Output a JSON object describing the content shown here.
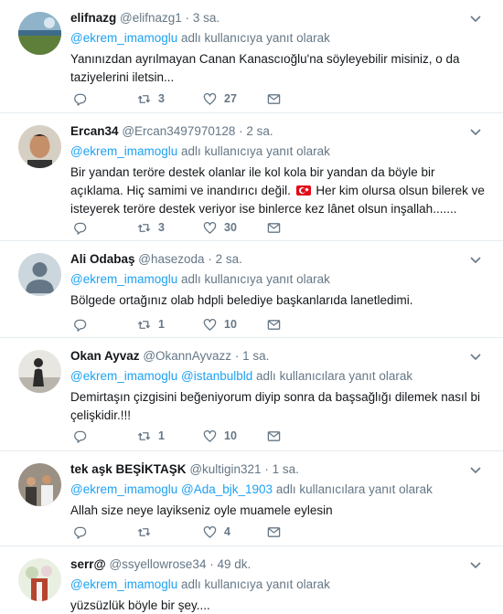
{
  "colors": {
    "link": "#1da1f2",
    "secondary_text": "#657786",
    "divider": "#e6ecf0"
  },
  "replying_text": "adlı kullanıcıya yanıt olarak",
  "replying_text_plural": "adlı kullanıcılara yanıt olarak",
  "tweets": [
    {
      "name": "elifnazg",
      "handle": "@elifnazg1",
      "time": "3 sa.",
      "mentions": [
        "@ekrem_imamoglu"
      ],
      "text": "Yanınızdan ayrılmayan Canan Kanascıoğlu'na söyleyebilir misiniz, o da taziyelerini iletsin...",
      "replies": "",
      "retweets": "3",
      "likes": "27",
      "avatar_icon": "landscape-photo"
    },
    {
      "name": "Ercan34",
      "handle": "@Ercan3497970128",
      "time": "2 sa.",
      "mentions": [
        "@ekrem_imamoglu"
      ],
      "text_before_flag": "Bir yandan teröre destek olanlar ile kol kola bir yandan da böyle bir açıklama. Hiç samimi ve inandırıcı değil.",
      "flag_icon": "turkey-flag-emoji",
      "text_after_flag": "Her kim olursa olsun bilerek ve isteyerek teröre destek veriyor ise binlerce kez lânet olsun inşallah.......",
      "replies": "",
      "retweets": "3",
      "likes": "30",
      "avatar_icon": "portrait-photo"
    },
    {
      "name": "Ali Odabaş",
      "handle": "@hasezoda",
      "time": "2 sa.",
      "mentions": [
        "@ekrem_imamoglu"
      ],
      "text": "Bölgede ortağınız olab hdpli belediye başkanlarıda lanetledimi.",
      "replies": "",
      "retweets": "1",
      "likes": "10",
      "avatar_icon": "default-avatar"
    },
    {
      "name": "Okan Ayvaz",
      "handle": "@OkannAyvazz",
      "time": "1 sa.",
      "mentions": [
        "@ekrem_imamoglu",
        "@istanbulbld"
      ],
      "text": "Demirtaşın çizgisini beğeniyorum diyip sonra da başsağlığı dilemek nasıl bi çelişkidir.!!!",
      "replies": "",
      "retweets": "1",
      "likes": "10",
      "avatar_icon": "silhouette-photo"
    },
    {
      "name": "tek aşk BEŞİKTAŞK",
      "handle": "@kultigin321",
      "time": "1 sa.",
      "mentions": [
        "@ekrem_imamoglu",
        "@Ada_bjk_1903"
      ],
      "text": "Allah size neye layikseniz oyle muamele eylesin",
      "replies": "",
      "retweets": "",
      "likes": "4",
      "avatar_icon": "group-photo"
    },
    {
      "name": "serr@",
      "handle": "@ssyellowrose34",
      "time": "49 dk.",
      "mentions": [
        "@ekrem_imamoglu"
      ],
      "text": "yüzsüzlük böyle bir şey....",
      "replies": "",
      "retweets": "",
      "likes": "",
      "avatar_icon": "flowers-photo"
    }
  ]
}
